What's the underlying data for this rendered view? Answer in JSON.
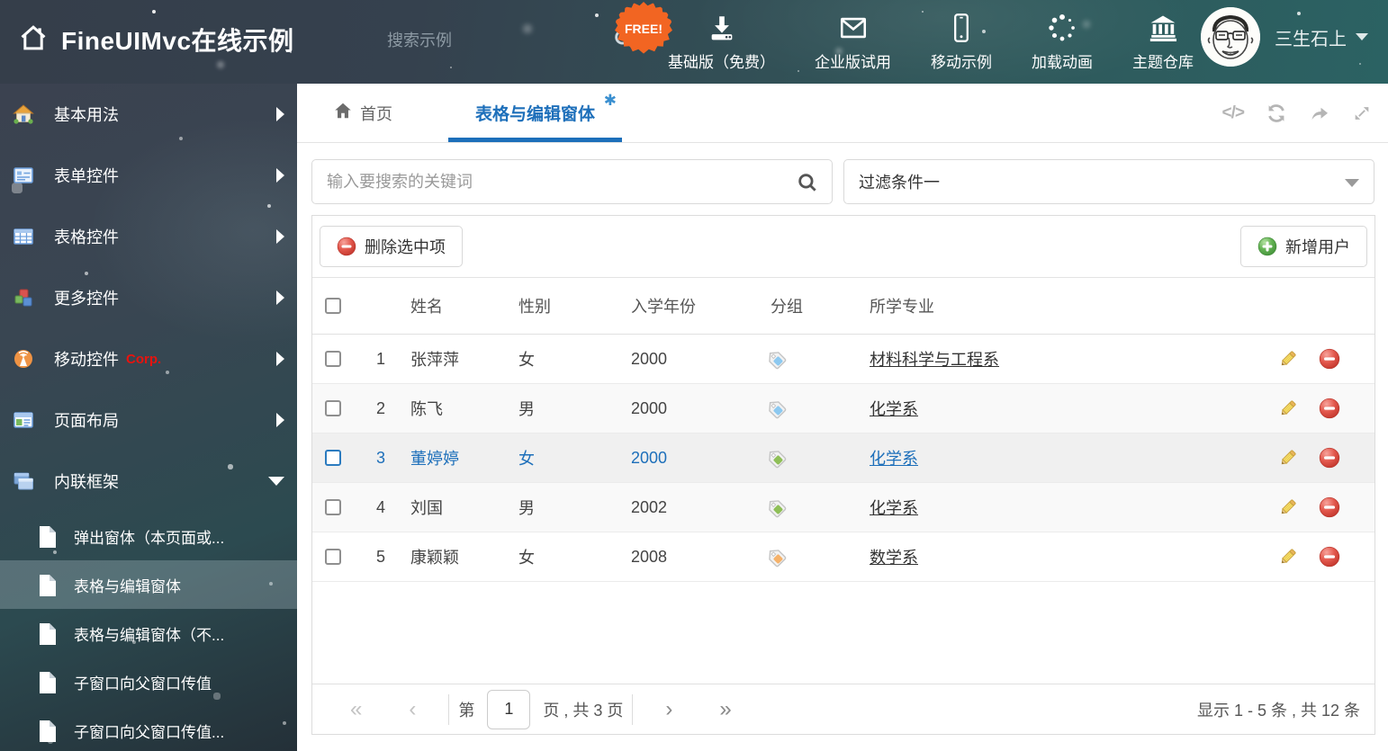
{
  "header": {
    "title": "FineUIMvc在线示例",
    "search_placeholder": "搜索示例",
    "free_badge": "FREE!",
    "nav": [
      {
        "label": "基础版（免费）",
        "icon": "download-icon"
      },
      {
        "label": "企业版试用",
        "icon": "envelope-icon"
      },
      {
        "label": "移动示例",
        "icon": "mobile-icon"
      },
      {
        "label": "加载动画",
        "icon": "spinner-icon"
      },
      {
        "label": "主题仓库",
        "icon": "bank-icon"
      }
    ],
    "user": {
      "name": "三生石上"
    }
  },
  "sidebar": {
    "items": [
      {
        "label": "基本用法",
        "icon": "house-icon"
      },
      {
        "label": "表单控件",
        "icon": "form-icon"
      },
      {
        "label": "表格控件",
        "icon": "table-icon"
      },
      {
        "label": "更多控件",
        "icon": "cubes-icon"
      },
      {
        "label": "移动控件",
        "badge": "Corp.",
        "icon": "antenna-icon"
      },
      {
        "label": "页面布局",
        "icon": "layout-icon"
      },
      {
        "label": "内联框架",
        "icon": "frames-icon"
      }
    ],
    "subitems": [
      {
        "label": "弹出窗体（本页面或..."
      },
      {
        "label": "表格与编辑窗体"
      },
      {
        "label": "表格与编辑窗体（不..."
      },
      {
        "label": "子窗口向父窗口传值"
      },
      {
        "label": "子窗口向父窗口传值..."
      }
    ]
  },
  "tabs": {
    "home": "首页",
    "active": "表格与编辑窗体"
  },
  "filters": {
    "search_placeholder": "输入要搜索的关键词",
    "filter_value": "过滤条件一"
  },
  "toolbar": {
    "delete_label": "删除选中项",
    "add_label": "新增用户"
  },
  "table": {
    "columns": {
      "name": "姓名",
      "gender": "性别",
      "year": "入学年份",
      "group": "分组",
      "major": "所学专业"
    },
    "rows": [
      {
        "num": "1",
        "name": "张萍萍",
        "gender": "女",
        "year": "2000",
        "tag_color": "blue",
        "major": "材料科学与工程系"
      },
      {
        "num": "2",
        "name": "陈飞",
        "gender": "男",
        "year": "2000",
        "tag_color": "blue",
        "major": "化学系"
      },
      {
        "num": "3",
        "name": "董婷婷",
        "gender": "女",
        "year": "2000",
        "tag_color": "green",
        "major": "化学系"
      },
      {
        "num": "4",
        "name": "刘国",
        "gender": "男",
        "year": "2002",
        "tag_color": "green",
        "major": "化学系"
      },
      {
        "num": "5",
        "name": "康颖颖",
        "gender": "女",
        "year": "2008",
        "tag_color": "orange",
        "major": "数学系"
      }
    ]
  },
  "pagination": {
    "first": "«",
    "prev": "‹",
    "next": "›",
    "last": "»",
    "page_prefix": "第",
    "page_value": "1",
    "page_suffix": "页 , 共 3 页",
    "summary": "显示 1 - 5 条 , 共 12 条"
  },
  "colors": {
    "accent_blue": "#1d6fba",
    "delete_red": "#e2574c",
    "add_green": "#5cb85c",
    "free_orange": "#f26522",
    "tag_blue": "#8dc9f0",
    "tag_green": "#8fbf58",
    "tag_orange": "#f5b26b"
  }
}
